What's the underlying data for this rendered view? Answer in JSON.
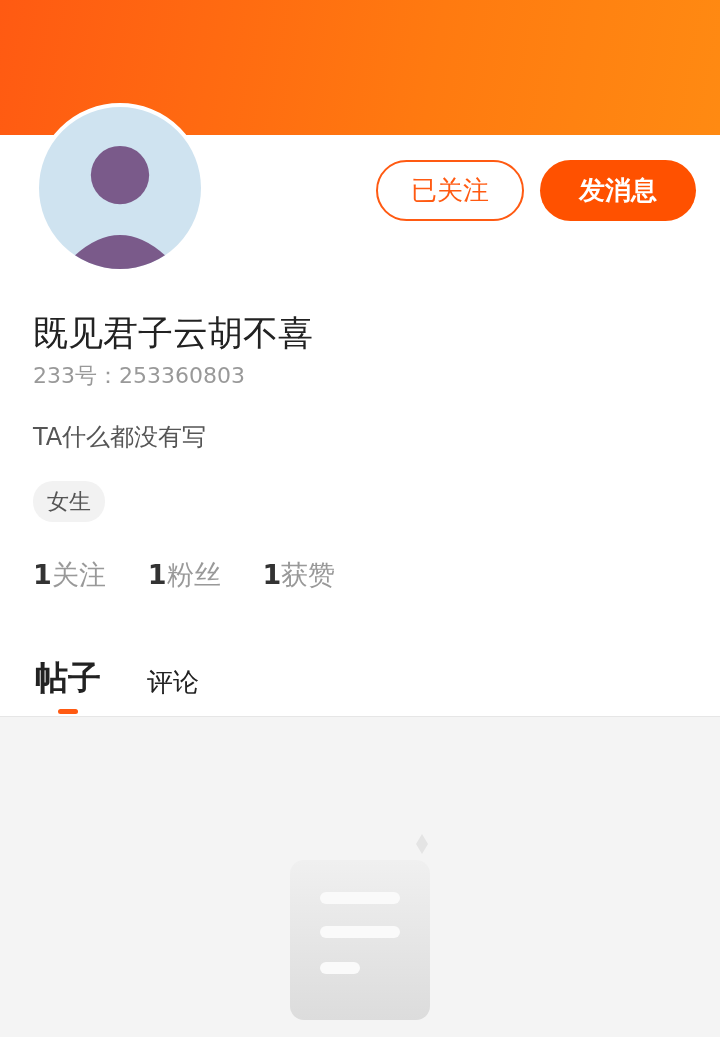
{
  "profile": {
    "name": "既见君子云胡不喜",
    "id_line": "233号：253360803",
    "bio": "TA什么都没有写",
    "tags": [
      "女生"
    ]
  },
  "actions": [
    {
      "label": "已关注",
      "kind": "outline"
    },
    {
      "label": "发消息",
      "kind": "filled"
    }
  ],
  "stats": [
    {
      "number": "1",
      "label": "关注"
    },
    {
      "number": "1",
      "label": "粉丝"
    },
    {
      "number": "1",
      "label": "获赞"
    }
  ],
  "tabs": [
    {
      "label": "帖子",
      "selected": true
    },
    {
      "label": "评论",
      "selected": false
    }
  ]
}
